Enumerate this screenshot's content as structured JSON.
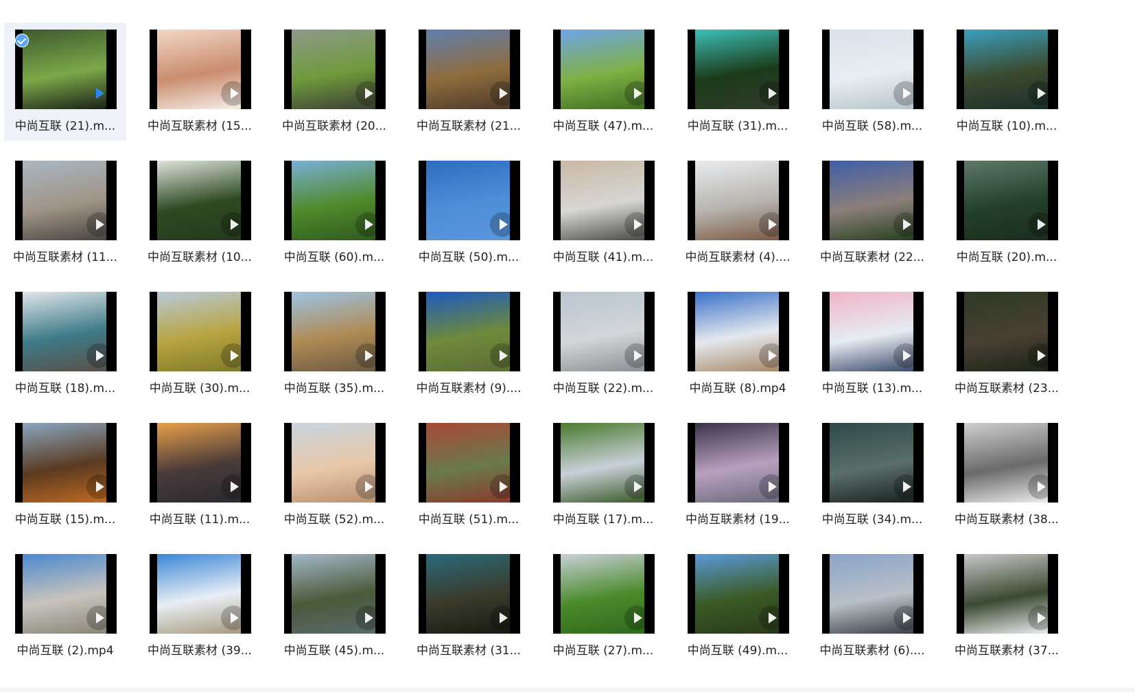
{
  "files": [
    {
      "name": "中尚互联 (21).m...",
      "selected": true,
      "colors": [
        "#3e5a2e",
        "#7ca848",
        "#1a2118"
      ]
    },
    {
      "name": "中尚互联素材 (15...",
      "colors": [
        "#f3d7c6",
        "#c98d6e",
        "#f6eee8"
      ]
    },
    {
      "name": "中尚互联素材 (20...",
      "colors": [
        "#8e9a8a",
        "#6f9a3b",
        "#3b3e36"
      ]
    },
    {
      "name": "中尚互联素材 (21...",
      "colors": [
        "#5f7fae",
        "#8f6c3d",
        "#4b3b2b"
      ]
    },
    {
      "name": "中尚互联 (47).m...",
      "colors": [
        "#6ea5e8",
        "#7fb044",
        "#3f6d23"
      ]
    },
    {
      "name": "中尚互联 (31).m...",
      "colors": [
        "#3cc0b8",
        "#1c3b1a",
        "#2f3b2a"
      ]
    },
    {
      "name": "中尚互联 (58).m...",
      "colors": [
        "#d8e2ec",
        "#e8eef2",
        "#b7c4cc"
      ]
    },
    {
      "name": "中尚互联 (10).m...",
      "colors": [
        "#3aa0c0",
        "#3b4a2e",
        "#1c2f2c"
      ]
    },
    {
      "name": "中尚互联素材 (11...",
      "colors": [
        "#a8b7c4",
        "#a09486",
        "#4a4540"
      ]
    },
    {
      "name": "中尚互联素材 (10...",
      "colors": [
        "#dfe3dc",
        "#2d4a22",
        "#253a1d"
      ]
    },
    {
      "name": "中尚互联 (60).m...",
      "colors": [
        "#7ab0d6",
        "#4f8a2c",
        "#2f5a1e"
      ]
    },
    {
      "name": "中尚互联 (50).m...",
      "colors": [
        "#2f6cc0",
        "#4d8fd8",
        "#5a95dc"
      ]
    },
    {
      "name": "中尚互联 (41).m...",
      "colors": [
        "#c9b8a4",
        "#d7d6d3",
        "#4b4a46"
      ]
    },
    {
      "name": "中尚互联素材 (4)....",
      "colors": [
        "#e8ecf0",
        "#b8b4ae",
        "#7a5a44"
      ]
    },
    {
      "name": "中尚互联素材 (22...",
      "colors": [
        "#3f5ea8",
        "#8c7f7a",
        "#24401e"
      ]
    },
    {
      "name": "中尚互联 (20).m...",
      "colors": [
        "#5f786a",
        "#244028",
        "#1a2e1c"
      ]
    },
    {
      "name": "中尚互联 (18).m...",
      "colors": [
        "#dfe6ea",
        "#3e7a88",
        "#5a5048"
      ]
    },
    {
      "name": "中尚互联 (30).m...",
      "colors": [
        "#b8cad8",
        "#b8a440",
        "#7e7a2a"
      ]
    },
    {
      "name": "中尚互联 (35).m...",
      "colors": [
        "#9cc4e4",
        "#b08a54",
        "#6a5a44"
      ]
    },
    {
      "name": "中尚互联素材 (9)....",
      "colors": [
        "#1d5ac0",
        "#6e8a3a",
        "#5a6e36"
      ]
    },
    {
      "name": "中尚互联 (22).m...",
      "colors": [
        "#b9c6d4",
        "#d2d6d8",
        "#8a9096"
      ]
    },
    {
      "name": "中尚互联 (8).mp4",
      "colors": [
        "#3a70c8",
        "#e4e8ee",
        "#a88a6a"
      ]
    },
    {
      "name": "中尚互联 (13).m...",
      "colors": [
        "#f0b4c8",
        "#e6ecf2",
        "#3a4a6a"
      ]
    },
    {
      "name": "中尚互联素材 (23...",
      "colors": [
        "#2b3a24",
        "#4a4032",
        "#1c2418"
      ]
    },
    {
      "name": "中尚互联 (15).m...",
      "colors": [
        "#8aa6c0",
        "#5a3a20",
        "#c06a22"
      ]
    },
    {
      "name": "中尚互联 (11).m...",
      "colors": [
        "#e8a04a",
        "#4a3a3a",
        "#2a2a30"
      ]
    },
    {
      "name": "中尚互联 (52).m...",
      "colors": [
        "#c8d4e0",
        "#e8c8a8",
        "#b89070"
      ]
    },
    {
      "name": "中尚互联 (51).m...",
      "colors": [
        "#a84838",
        "#6a7a4a",
        "#8a3a2e"
      ]
    },
    {
      "name": "中尚互联 (17).m...",
      "colors": [
        "#4a7a2e",
        "#c8d0d8",
        "#3a5a28"
      ]
    },
    {
      "name": "中尚互联素材 (19...",
      "colors": [
        "#3a3248",
        "#b8a0c0",
        "#6a6a7a"
      ]
    },
    {
      "name": "中尚互联 (34).m...",
      "colors": [
        "#2c4a4a",
        "#5a6e6a",
        "#1a2222"
      ]
    },
    {
      "name": "中尚互联素材 (38...",
      "colors": [
        "#cfcfcf",
        "#6a6a6a",
        "#ececec"
      ]
    },
    {
      "name": "中尚互联 (2).mp4",
      "colors": [
        "#4a88d0",
        "#c8c4bc",
        "#8a8478"
      ]
    },
    {
      "name": "中尚互联素材 (39...",
      "colors": [
        "#3a86d8",
        "#e8eef4",
        "#a89a80"
      ]
    },
    {
      "name": "中尚互联 (45).m...",
      "colors": [
        "#a4b8c8",
        "#4a5a3a",
        "#5a6a6a"
      ]
    },
    {
      "name": "中尚互联素材 (31...",
      "colors": [
        "#2a6a7a",
        "#3a3a2a",
        "#1a1a14"
      ]
    },
    {
      "name": "中尚互联 (27).m...",
      "colors": [
        "#c8d0d8",
        "#4a8a2a",
        "#2e6a1e"
      ]
    },
    {
      "name": "中尚互联 (49).m...",
      "colors": [
        "#5a9ad8",
        "#3a5a24",
        "#2a3a1c"
      ]
    },
    {
      "name": "中尚互联素材 (6)....",
      "colors": [
        "#8aa4c8",
        "#b8c0c8",
        "#3a4048"
      ]
    },
    {
      "name": "中尚互联素材 (37...",
      "colors": [
        "#c8c8c8",
        "#3a4a30",
        "#e8ecee"
      ]
    }
  ]
}
